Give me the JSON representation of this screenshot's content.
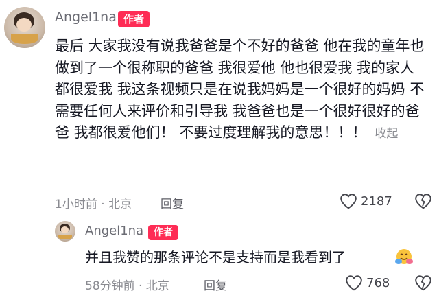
{
  "comment": {
    "username": "Angel1na",
    "author_badge": "作者",
    "text": "最后 大家我没有说我爸爸是个不好的爸爸 他在我的童年也做到了一个很称职的爸爸 我很爱他 他也很爱我 我的家人都很爱我 我这条视频只是在说我妈妈是一个很好的妈妈 不需要任何人来评价和引导我 我爸爸也是一个很好很好的爸爸 我都很爱他们！ 不要过度理解我的意思！！！",
    "collapse_label": "收起",
    "time": "1小时前 · 北京",
    "reply_label": "回复",
    "like_count": "2187"
  },
  "reply": {
    "username": "Angel1na",
    "author_badge": "作者",
    "text": "并且我赞的那条评论不是支持而是我看到了",
    "emoji": "hug-emoji",
    "time": "58分钟前 · 北京",
    "reply_label": "回复",
    "like_count": "768"
  },
  "colors": {
    "badge": "#fe2c55",
    "meta": "#8a8b91",
    "text": "#161823"
  }
}
